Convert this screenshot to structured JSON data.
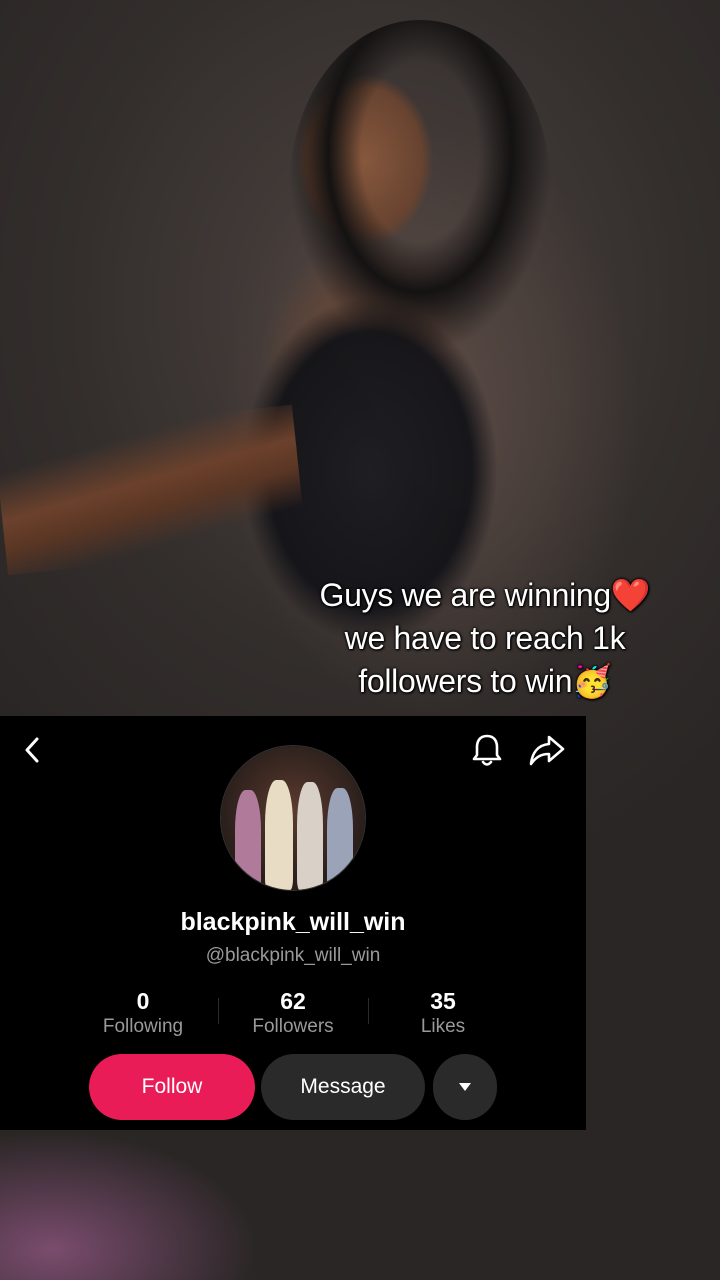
{
  "caption": {
    "line1": "Guys we are winning",
    "line1_emoji": "❤️",
    "line2": "we have to reach 1k",
    "line3": "followers to win",
    "line3_emoji": "🥳"
  },
  "profile": {
    "display_name": "blackpink_will_win",
    "handle": "@blackpink_will_win",
    "stats": [
      {
        "value": "0",
        "label": "Following"
      },
      {
        "value": "62",
        "label": "Followers"
      },
      {
        "value": "35",
        "label": "Likes"
      }
    ],
    "buttons": {
      "follow": "Follow",
      "message": "Message"
    }
  },
  "icons": {
    "back": "chevron-left-icon",
    "notifications": "bell-icon",
    "share": "share-arrow-icon",
    "more": "caret-down-icon"
  },
  "colors": {
    "follow_button": "#ea1c57",
    "secondary_button": "#2a2a2a",
    "card_background": "#000000",
    "muted_text": "#9a9a9a"
  }
}
